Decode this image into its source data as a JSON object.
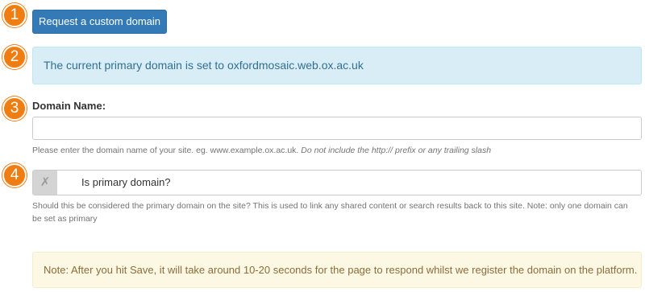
{
  "steps": [
    "1",
    "2",
    "3",
    "4"
  ],
  "request_button": {
    "label": "Request a custom domain"
  },
  "info_alert": {
    "text": "The current primary domain is set to oxfordmosaic.web.ox.ac.uk"
  },
  "domain_field": {
    "label": "Domain Name:",
    "value": "",
    "placeholder": "",
    "help": "Please enter the domain name of your site. eg. www.example.ox.ac.uk.",
    "help_italic": "Do not include the http:// prefix or any trailing slash"
  },
  "primary_toggle": {
    "state_glyph": "✗",
    "label": "Is primary domain?",
    "help_line1": "Should this be considered the primary domain on the site? This is used to link any shared content or search results back to this site. Note: only one domain can",
    "help_line2": "be set as primary"
  },
  "warning_alert": {
    "text": "Note: After you hit Save, it will take around 10-20 seconds for the page to respond whilst we register the domain on the platform."
  },
  "colors": {
    "step_badge": "#f07d12",
    "primary_button": "#337ab7",
    "info_bg": "#d9edf7",
    "info_text": "#31708f",
    "warning_bg": "#fcf8e3",
    "warning_text": "#8a6d3b"
  }
}
